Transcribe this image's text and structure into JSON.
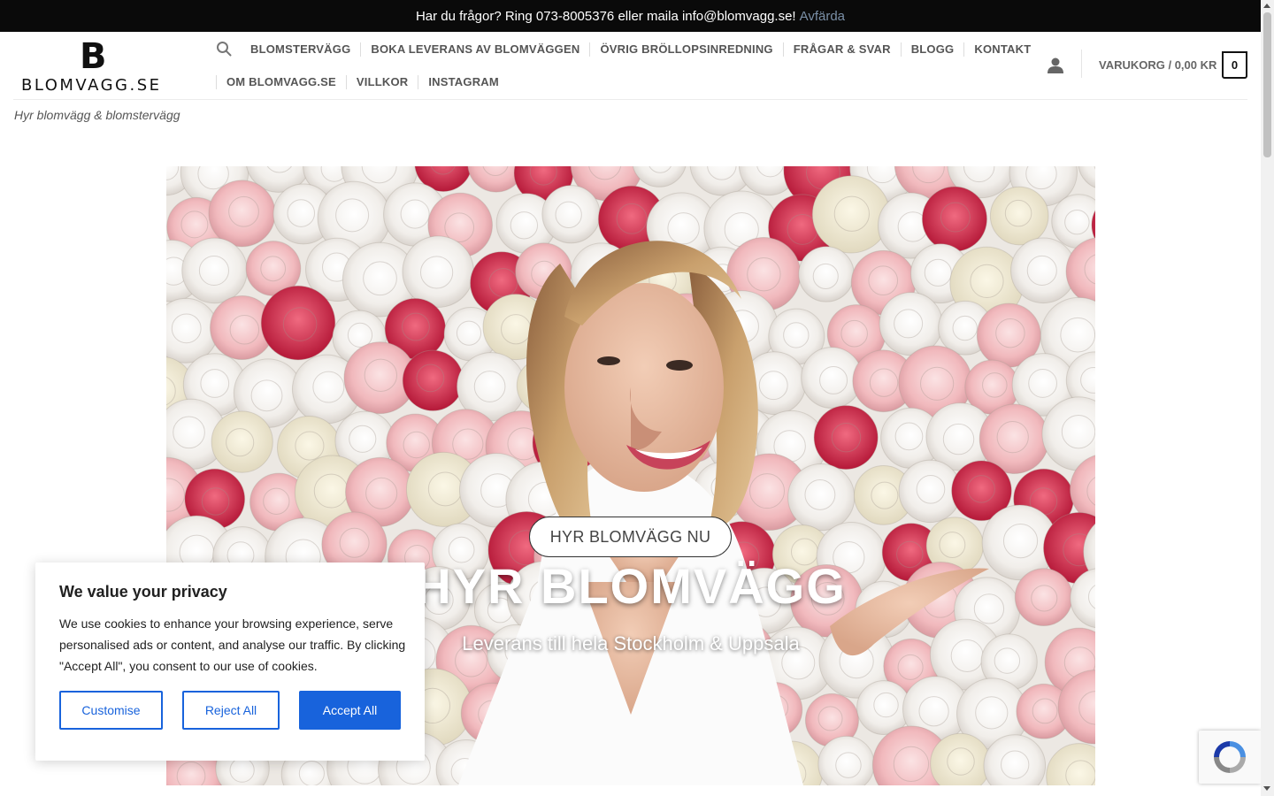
{
  "topbar": {
    "message": "Har du frågor? Ring 073-8005376 eller maila info@blomvagg.se!",
    "dismiss_label": "Avfärda"
  },
  "header": {
    "logo_mark": "B",
    "logo_text": "BLOMVAGG.SE",
    "nav_row1": [
      "BLOMSTERVÄGG",
      "BOKA LEVERANS AV BLOMVÄGGEN",
      "ÖVRIG BRÖLLOPSINREDNING",
      "FRÅGAR & SVAR",
      "BLOGG",
      "KONTAKT"
    ],
    "nav_row2": [
      "OM BLOMVAGG.SE",
      "VILLKOR",
      "INSTAGRAM"
    ],
    "cart_label": "VARUKORG / 0,00 KR",
    "cart_count": "0"
  },
  "tagline": "Hyr blomvägg & blomstervägg",
  "hero": {
    "title": "HYR BLOMVÄGG",
    "subtitle": "Leverans till hela Stockholm & Uppsala",
    "button_label": "HYR BLOMVÄGG NU"
  },
  "cookie_banner": {
    "title": "We value your privacy",
    "text": "We use cookies to enhance your browsing experience, serve personalised ads or content, and analyse our traffic. By clicking \"Accept All\", you consent to our use of cookies.",
    "customise_label": "Customise",
    "reject_label": "Reject All",
    "accept_label": "Accept All"
  },
  "colors": {
    "topbar_bg": "#0a0a0a",
    "dismiss_link": "#7a8fa6",
    "cookie_accent": "#1863dc"
  },
  "icons": {
    "search": "search-icon",
    "account": "user-icon",
    "recaptcha": "recaptcha-icon"
  }
}
